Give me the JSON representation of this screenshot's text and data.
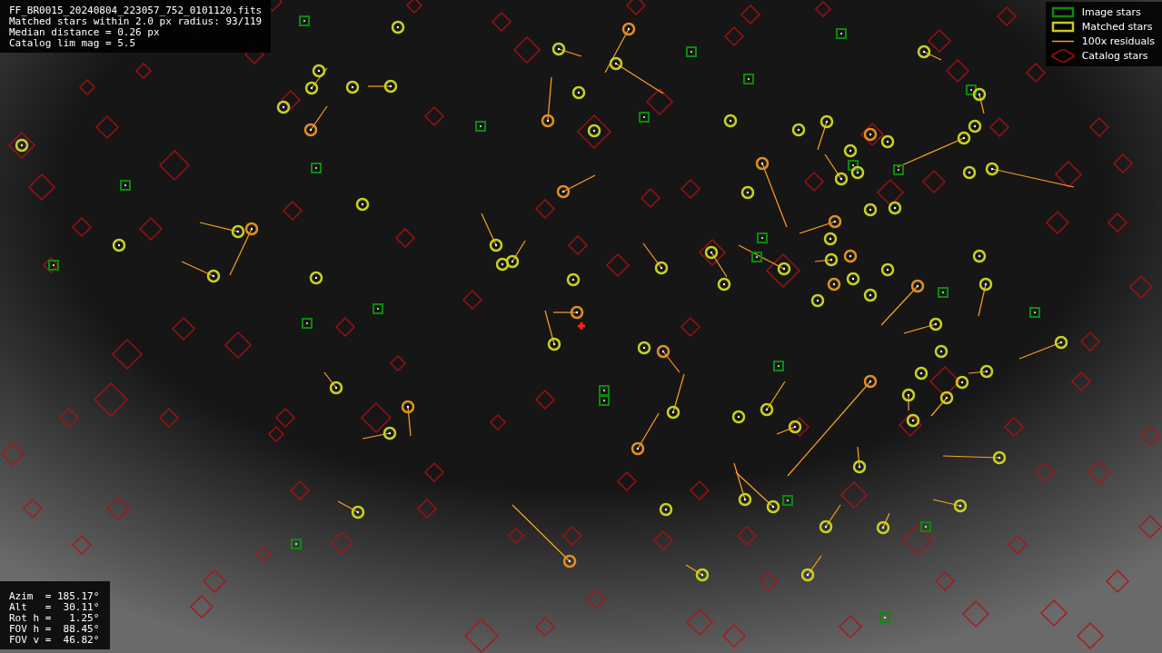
{
  "info_lines": [
    "FF_BR0015_20240804_223057_752_0101120.fits",
    "Matched stars within 2.0 px radius: 93/119",
    "Median distance = 0.26 px",
    "Catalog lim mag = 5.5"
  ],
  "legend": [
    {
      "kind": "image",
      "label": "Image stars"
    },
    {
      "kind": "matched",
      "label": "Matched stars"
    },
    {
      "kind": "residual",
      "label": "100x residuals"
    },
    {
      "kind": "catalog",
      "label": "Catalog stars"
    }
  ],
  "pointing": [
    "Azim  = 185.17°",
    "Alt   =  30.11°",
    "Rot h =   1.25°",
    "FOV h =  88.45°",
    "FOV v =  46.82°"
  ]
}
